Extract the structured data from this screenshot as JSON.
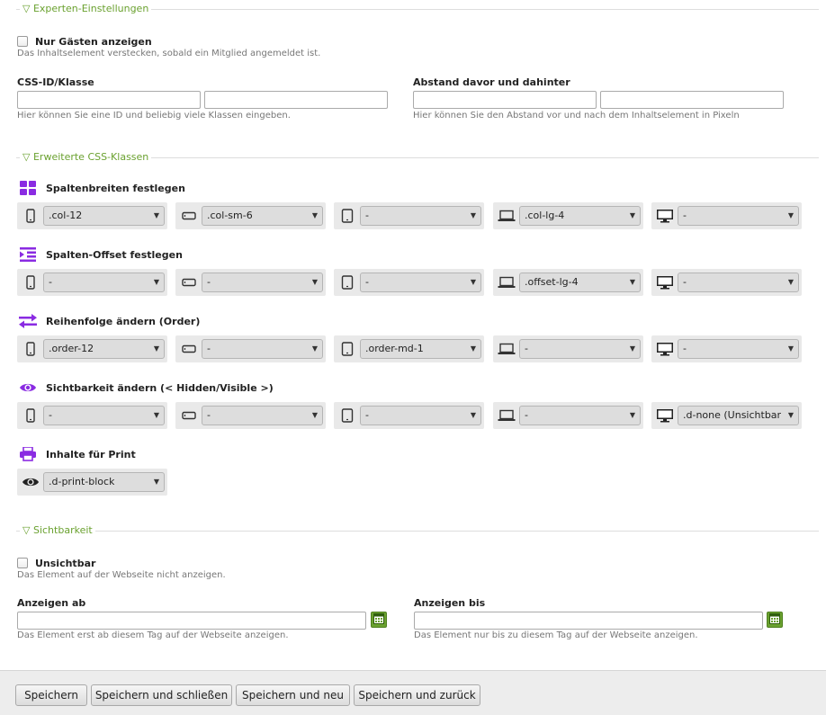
{
  "sections": {
    "expert": "Experten-Einstellungen",
    "css_classes": "Erweiterte CSS-Klassen",
    "visibility": "Sichtbarkeit"
  },
  "guests": {
    "label": "Nur Gästen anzeigen",
    "help": "Das Inhaltselement verstecken, sobald ein Mitglied angemeldet ist."
  },
  "cssid": {
    "label": "CSS-ID/Klasse",
    "help": "Hier können Sie eine ID und beliebig viele Klassen eingeben.",
    "value1": "",
    "value2": ""
  },
  "spacing": {
    "label": "Abstand davor und dahinter",
    "help": "Hier können Sie den Abstand vor und nach dem Inhaltselement in Pixeln",
    "value1": "",
    "value2": ""
  },
  "column_widths": {
    "title": "Spaltenbreiten festlegen",
    "icon": "grid-icon",
    "values": [
      ".col-12",
      ".col-sm-6",
      "-",
      ".col-lg-4",
      "-"
    ]
  },
  "column_offset": {
    "title": "Spalten-Offset festlegen",
    "icon": "indent-icon",
    "values": [
      "-",
      "-",
      "-",
      ".offset-lg-4",
      "-"
    ]
  },
  "order": {
    "title": "Reihenfolge ändern (Order)",
    "icon": "swap-icon",
    "values": [
      ".order-12",
      "-",
      ".order-md-1",
      "-",
      "-"
    ]
  },
  "visibility_change": {
    "title": "Sichtbarkeit ändern (< Hidden/Visible >)",
    "icon": "eye-icon",
    "values": [
      "-",
      "-",
      "-",
      "-",
      ".d-none (Unsichtbar"
    ]
  },
  "print": {
    "title": "Inhalte für Print",
    "icon": "printer-icon",
    "value": ".d-print-block"
  },
  "devices": [
    "phone-icon",
    "phone-landscape-icon",
    "tablet-icon",
    "laptop-icon",
    "desktop-icon"
  ],
  "invisible": {
    "label": "Unsichtbar",
    "help": "Das Element auf der Webseite nicht anzeigen."
  },
  "show_from": {
    "label": "Anzeigen ab",
    "help": "Das Element erst ab diesem Tag auf der Webseite anzeigen.",
    "value": ""
  },
  "show_until": {
    "label": "Anzeigen bis",
    "help": "Das Element nur bis zu diesem Tag auf der Webseite anzeigen.",
    "value": ""
  },
  "buttons": {
    "save": "Speichern",
    "save_close": "Speichern und schließen",
    "save_new": "Speichern und neu",
    "save_back": "Speichern und zurück"
  },
  "colors": {
    "accent_green": "#6aa12f",
    "icon_purple": "#8a2be2"
  }
}
